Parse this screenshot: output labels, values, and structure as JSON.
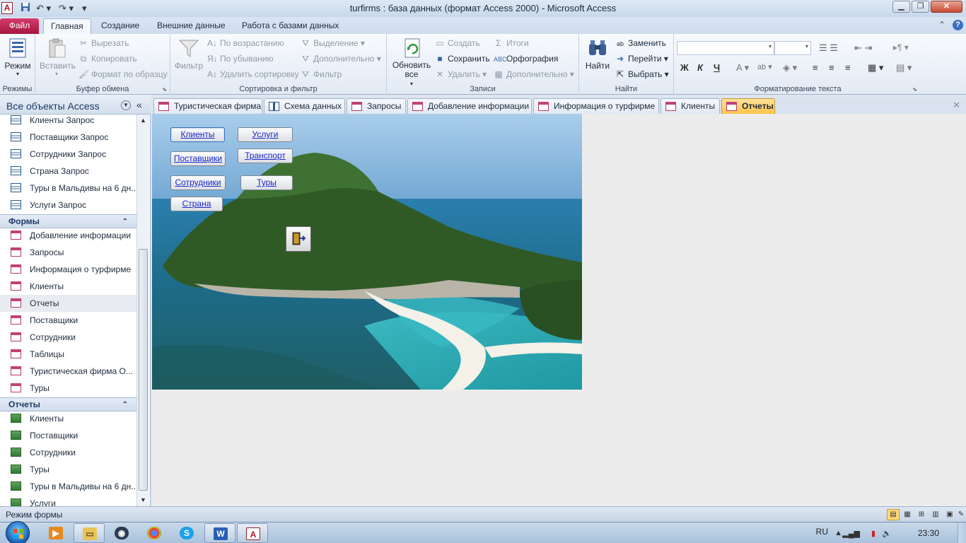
{
  "window": {
    "title": "turfirms : база данных (формат Access 2000)  -  Microsoft Access",
    "app_icon": "A",
    "controls": [
      "minimize-icon",
      "restore-icon",
      "close-icon"
    ]
  },
  "ribbon_tabs": {
    "file": "Файл",
    "items": [
      "Главная",
      "Создание",
      "Внешние данные",
      "Работа с базами данных"
    ],
    "active": "Главная"
  },
  "ribbon": {
    "views": {
      "label": "Режим",
      "group": "Режимы"
    },
    "clipboard": {
      "group": "Буфер обмена",
      "paste": "Вставить",
      "cut": "Вырезать",
      "copy": "Копировать",
      "format_painter": "Формат по образцу"
    },
    "sortfilter": {
      "group": "Сортировка и фильтр",
      "filter": "Фильтр",
      "ascending": "По возрастанию",
      "descending": "По убыванию",
      "remove_sort": "Удалить сортировку",
      "selection": "Выделение",
      "advanced": "Дополнительно",
      "toggle_filter": "Фильтр"
    },
    "records": {
      "group": "Записи",
      "refresh": "Обновить все",
      "new": "Создать",
      "save": "Сохранить",
      "delete": "Удалить",
      "totals": "Итоги",
      "spelling": "Орфография",
      "more": "Дополнительно"
    },
    "find": {
      "group": "Найти",
      "find": "Найти",
      "replace": "Заменить",
      "goto": "Перейти",
      "select": "Выбрать"
    },
    "text_format": {
      "group": "Форматирование текста",
      "bold": "Ж",
      "italic": "К",
      "underline": "Ч"
    }
  },
  "nav": {
    "header": "Все объекты Access",
    "queries": [
      "Клиенты Запрос",
      "Поставщики Запрос",
      "Сотрудники Запрос",
      "Страна Запрос",
      "Туры в Мальдивы на 6 дн...",
      "Услуги Запрос"
    ],
    "forms_header": "Формы",
    "forms": [
      "Добавление информации",
      "Запросы",
      "Информация о турфирме",
      "Клиенты",
      "Отчеты",
      "Поставщики",
      "Сотрудники",
      "Таблицы",
      "Туристическая фирма О...",
      "Туры"
    ],
    "selected_form": "Отчеты",
    "reports_header": "Отчеты",
    "reports": [
      "Клиенты",
      "Поставщики",
      "Сотрудники",
      "Туры",
      "Туры в Мальдивы на 6 дн...",
      "Услуги"
    ]
  },
  "doc_tabs": [
    {
      "label": "Туристическая фирма",
      "icon": "form"
    },
    {
      "label": "Схема данных",
      "icon": "relationship"
    },
    {
      "label": "Запросы",
      "icon": "form"
    },
    {
      "label": "Добавление информации",
      "icon": "form"
    },
    {
      "label": "Информация о турфирме",
      "icon": "form"
    },
    {
      "label": "Клиенты",
      "icon": "form"
    },
    {
      "label": "Отчеты",
      "icon": "form",
      "active": true
    }
  ],
  "form": {
    "buttons": [
      "Клиенты",
      "Услуги",
      "Поставщики",
      "Транспорт",
      "Сотрудники",
      "Туры",
      "Страна"
    ],
    "exit_icon": "exit-door-icon"
  },
  "status": {
    "text": "Режим формы"
  },
  "taskbar": {
    "lang": "RU",
    "clock": "23:30"
  }
}
